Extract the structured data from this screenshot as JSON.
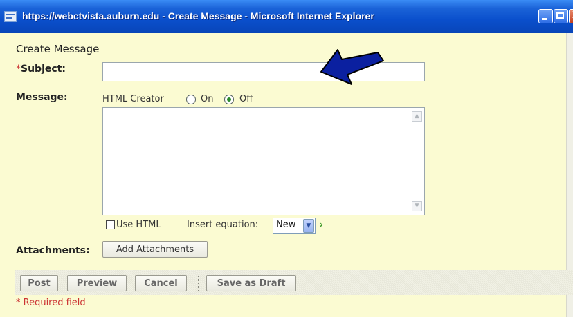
{
  "window": {
    "title": "https://webctvista.auburn.edu - Create Message - Microsoft Internet Explorer"
  },
  "form": {
    "heading": "Create Message",
    "required_marker": "*",
    "subject_label": "Subject:",
    "subject_value": "",
    "message_label": "Message:",
    "html_creator_label": "HTML Creator",
    "html_creator_options": [
      "On",
      "Off"
    ],
    "html_creator_selected": "Off",
    "message_value": "",
    "use_html_label": "Use HTML",
    "use_html_checked": false,
    "insert_equation_label": "Insert equation:",
    "insert_equation_selected": "New",
    "attachments_label": "Attachments:",
    "add_attachments_button": "Add Attachments"
  },
  "actions": {
    "post": "Post",
    "preview": "Preview",
    "cancel": "Cancel",
    "save_draft": "Save as Draft"
  },
  "footer": {
    "required_note": "* Required field"
  },
  "colors": {
    "background": "#fbfbd2",
    "titlebar": "#0a4fcc",
    "required": "#cc3333",
    "arrow": "#0b20a0"
  }
}
